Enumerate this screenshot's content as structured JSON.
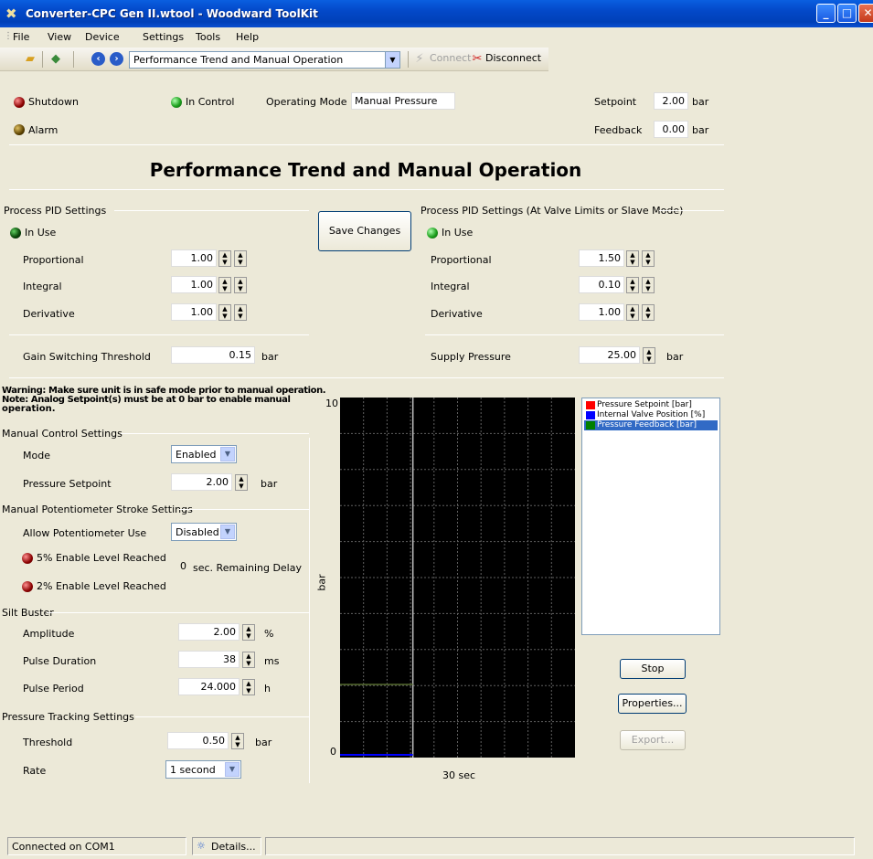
{
  "window": {
    "title": "Converter-CPC Gen II.wtool - Woodward ToolKit"
  },
  "menu": [
    "File",
    "View",
    "Device",
    "Settings",
    "Tools",
    "Help"
  ],
  "toolbar": {
    "page": "Performance Trend and Manual Operation",
    "connect": "Connect",
    "disconnect": "Disconnect"
  },
  "status": {
    "shutdown": "Shutdown",
    "in_control": "In Control",
    "alarm": "Alarm",
    "operating_mode_label": "Operating Mode",
    "operating_mode": "Manual Pressure",
    "setpoint_label": "Setpoint",
    "setpoint": "2.00",
    "feedback_label": "Feedback",
    "feedback": "0.00",
    "unit": "bar"
  },
  "heading": "Performance Trend and Manual Operation",
  "pid": {
    "title": "Process PID Settings",
    "in_use": "In Use",
    "proportional_label": "Proportional",
    "proportional": "1.00",
    "integral_label": "Integral",
    "integral": "1.00",
    "derivative_label": "Derivative",
    "derivative": "1.00",
    "gain_label": "Gain Switching Threshold",
    "gain": "0.15",
    "unit": "bar"
  },
  "save_changes": "Save Changes",
  "pid2": {
    "title": "Process PID Settings (At Valve Limits or Slave Mode)",
    "in_use": "In Use",
    "proportional_label": "Proportional",
    "proportional": "1.50",
    "integral_label": "Integral",
    "integral": "0.10",
    "derivative_label": "Derivative",
    "derivative": "1.00",
    "supply_label": "Supply Pressure",
    "supply": "25.00",
    "unit": "bar"
  },
  "warning": {
    "line1": "Warning: Make sure unit is in safe mode prior to manual operation.",
    "line2": "Note: Analog Setpoint(s) must be at 0 bar to enable manual",
    "line3": "operation."
  },
  "manual": {
    "title": "Manual Control Settings",
    "mode_label": "Mode",
    "mode": "Enabled",
    "setpoint_label": "Pressure Setpoint",
    "setpoint": "2.00",
    "unit": "bar"
  },
  "pot": {
    "title": "Manual Potentiometer Stroke Settings",
    "allow_label": "Allow Potentiometer Use",
    "allow": "Disabled",
    "enable5": "5% Enable Level Reached",
    "enable2": "2% Enable Level Reached",
    "delay": "0",
    "delay_label": "sec. Remaining Delay"
  },
  "silt": {
    "title": "Silt Buster",
    "amp_label": "Amplitude",
    "amp": "2.00",
    "amp_unit": "%",
    "dur_label": "Pulse Duration",
    "dur": "38",
    "dur_unit": "ms",
    "period_label": "Pulse Period",
    "period": "24.000",
    "period_unit": "h"
  },
  "tracking": {
    "title": "Pressure Tracking Settings",
    "threshold_label": "Threshold",
    "threshold": "0.50",
    "unit": "bar",
    "rate_label": "Rate",
    "rate": "1 second"
  },
  "trend": {
    "ymax": "10",
    "ymin": "0",
    "ylabel": "bar",
    "xlabel": "30 sec",
    "legend": [
      {
        "name": "Pressure Setpoint [bar]",
        "color": "#ff0000"
      },
      {
        "name": "Internal Valve Position [%]",
        "color": "#0000ff"
      },
      {
        "name": "Pressure Feedback [bar]",
        "color": "#008000"
      }
    ],
    "setpoint_level": 2.0,
    "feedback_level": 0.0,
    "stop": "Stop",
    "properties": "Properties...",
    "export": "Export..."
  },
  "statusbar": {
    "connection": "Connected on COM1",
    "details": "Details..."
  }
}
